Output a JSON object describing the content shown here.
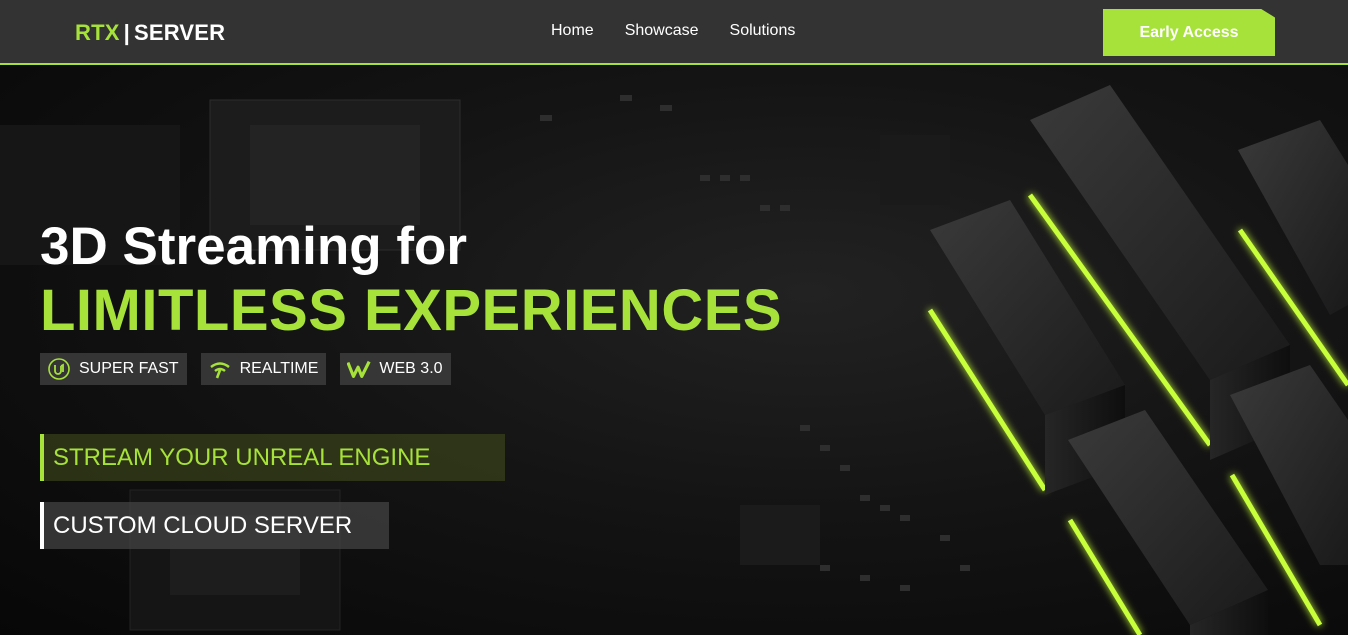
{
  "header": {
    "logo_left": "RTX",
    "logo_sep": "|",
    "logo_right": "SERVER",
    "nav": [
      "Home",
      "Showcase",
      "Solutions"
    ],
    "cta_label": "Early Access"
  },
  "hero": {
    "title_line1": "3D Streaming for",
    "title_line2": "LIMITLESS EXPERIENCES",
    "features": [
      {
        "icon": "unreal-icon",
        "label": "SUPER FAST"
      },
      {
        "icon": "signal-icon",
        "label": "REALTIME"
      },
      {
        "icon": "w-logo-icon",
        "label": "WEB 3.0"
      }
    ],
    "option1": "STREAM YOUR UNREAL ENGINE",
    "option2": "CUSTOM CLOUD SERVER"
  },
  "colors": {
    "accent": "#a6e23a",
    "header_bg": "#333333"
  }
}
